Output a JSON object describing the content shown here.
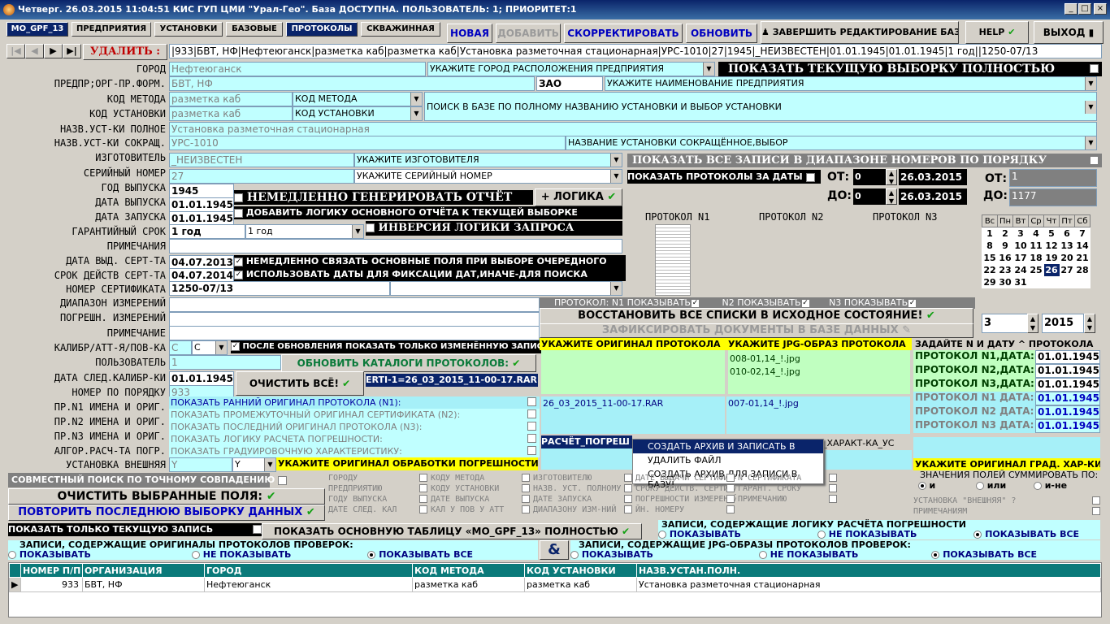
{
  "title": "Четверг. 26.03.2015 11:04:51 КИС ГУП ЦМИ \"Урал-Гео\". База ДОСТУПНА. ПОЛЬЗОВАТЕЛЬ: 1; ПРИОРИТЕТ:1",
  "tabs": [
    "MO_GPF_13",
    "ПРЕДПРИЯТИЯ",
    "УСТАНОВКИ",
    "БАЗОВЫЕ",
    "ПРОТОКОЛЫ",
    "СКВАЖИННАЯ"
  ],
  "actions": {
    "new": "НОВАЯ",
    "add": "ДОБАВИТЬ",
    "edit": "СКОРРЕКТИРОВАТЬ",
    "refresh": "ОБНОВИТЬ",
    "finish": "ЗАВЕРШИТЬ РЕДАКТИРОВАНИЕ БАЗЫ",
    "help": "HELP",
    "exit": "ВЫХОД"
  },
  "nav": {
    "delete": "УДАЛИТЬ :",
    "record": "|933|БВТ, НФ|Нефтеюганск|разметка каб|разметка каб|Установка разметочная стационарная|УРС-1010|27|1945|_НЕИЗВЕСТЕН|01.01.1945|01.01.1945|1 год||1250-07/13"
  },
  "labels": [
    "ГОРОД",
    "ПРЕДПР;ОРГ-ПР.ФОРМ.",
    "КОД МЕТОДА",
    "КОД УСТАНОВКИ",
    "НАЗВ.УСТ-КИ ПОЛНОЕ",
    "НАЗВ.УСТ-КИ СОКРАЩ.",
    "ИЗГОТОВИТЕЛЬ",
    "СЕРИЙНЫЙ НОМЕР",
    "ГОД ВЫПУСКА",
    "ДАТА ВЫПУСКА",
    "ДАТА ЗАПУСКА",
    "ГАРАНТИЙНЫЙ СРОК",
    "ПРИМЕЧАНИЯ",
    "ДАТА ВЫД. СЕРТ-ТА",
    "СРОК ДЕЙСТВ СЕРТ-ТА",
    "НОМЕР СЕРТИФИКАТА",
    "ДИАПАЗОН ИЗМЕРЕНИЙ",
    "ПОГРЕШН. ИЗМЕРЕНИЙ",
    "ПРИМЕЧАНИЕ",
    "КАЛИБР/АТТ-Я/ПОВ-КА",
    "ПОЛЬЗОВАТЕЛЬ",
    "ДАТА СЛЕД.КАЛИБР-КИ",
    "НОМЕР ПО ПОРЯДКУ",
    "ПР.N1 ИМЕНА И ОРИГ.",
    "ПР.N2 ИМЕНА И ОРИГ.",
    "ПР.N3 ИМЕНА И ОРИГ.",
    "АЛГОР.РАСЧ-ТА ПОГР.",
    "УСТАНОВКА ВНЕШНЯЯ"
  ],
  "fields": {
    "city": "Нефтеюганск",
    "city_hint": "УКАЖИТЕ ГОРОД РАСПОЛОЖЕНИЯ ПРЕДПРИЯТИЯ",
    "show_current": "ПОКАЗАТЬ ТЕКУЩУЮ ВЫБОРКУ ПОЛНОСТЬЮ",
    "org": "БВТ, НФ",
    "form": "ЗАО",
    "org_hint": "УКАЖИТЕ НАИМЕНОВАНИЕ ПРЕДПРИЯТИЯ",
    "method": "разметка каб",
    "method_sel": "КОД МЕТОДА",
    "unit": "разметка каб",
    "unit_sel": "КОД УСТАНОВКИ",
    "unit_search": "ПОИСК В БАЗЕ ПО ПОЛНОМУ НАЗВАНИЮ УСТАНОВКИ И ВЫБОР УСТАНОВКИ",
    "full_name": "Установка разметочная стационарная",
    "short_name": "УРС-1010",
    "short_hint": "НАЗВАНИЕ УСТАНОВКИ СОКРАЩЁННОЕ,ВЫБОР",
    "maker": "_НЕИЗВЕСТЕН",
    "maker_hint": "УКАЖИТЕ ИЗГОТОВИТЕЛЯ",
    "serial": "27",
    "serial_hint": "УКАЖИТЕ СЕРИЙНЫЙ НОМЕР",
    "year": "1945",
    "rel_date": "01.01.1945",
    "start_date": "01.01.1945",
    "warranty": "1 год",
    "warranty_sel": "1 год",
    "cert_date": "04.07.2013",
    "cert_valid": "04.07.2014",
    "cert_no": "1250-07/13",
    "calib": "С",
    "calib_sel": "С",
    "user": "1",
    "next_calib": "01.01.1945",
    "order_no": "933",
    "ext": "Y",
    "ext_sel": "Y"
  },
  "toggles": {
    "gen": "НЕМЕДЛЕННО ГЕНЕРИРОВАТЬ ОТЧЁТ",
    "logic": "+ ЛОГИКА",
    "add_logic": "ДОБАВИТЬ ЛОГИКУ ОСНОВНОГО ОТЧЁТА К ТЕКУЩЕЙ ВЫБОРКЕ",
    "invert": "ИНВЕРСИЯ ЛОГИКИ ЗАПРОСА",
    "link": "НЕМЕДЛЕННО СВЯЗАТЬ ОСНОВНЫЕ ПОЛЯ ПРИ ВЫБОРЕ ОЧЕРЕДНОГО",
    "use_dates": "ИСПОЛЬЗОВАТЬ ДАТЫ ДЛЯ ФИКСАЦИИ ДАТ,ИНАЧЕ-ДЛЯ ПОИСКА",
    "after_upd": "ПОСЛЕ ОБНОВЛЕНИЯ ПОКАЗАТЬ ТОЛЬКО ИЗМЕНЁННУЮ ЗАПИСЬ",
    "upd_cat": "ОБНОВИТЬ КАТАЛОГИ ПРОТОКОЛОВ:",
    "clear_all": "ОЧИСТИТЬ ВСЁ!",
    "rar": "ERTI-1=26_03_2015_11-00-17.RAR"
  },
  "range": {
    "show_all": "ПОКАЗАТЬ ВСЕ ЗАПИСИ В ДИАПАЗОНЕ НОМЕРОВ ПО ПОРЯДКУ",
    "by_date": "ПОКАЗАТЬ ПРОТОКОЛЫ ЗА ДАТЫ",
    "from": "ОТ:",
    "to": "ДО:",
    "from_n": "0",
    "to_n": "0",
    "from_d": "26.03.2015",
    "to_d": "26.03.2015",
    "from2": "1",
    "to2": "1177"
  },
  "protocols": {
    "p1": "ПРОТОКОЛ N1",
    "p2": "ПРОТОКОЛ N2",
    "p3": "ПРОТОКОЛ N3",
    "show_prefix": "ПРОТОКОЛ:",
    "s1": "N1 ПОКАЗЫВАТЬ",
    "s2": "N2 ПОКАЗЫВАТЬ",
    "s3": "N3 ПОКАЗЫВАТЬ",
    "restore": "ВОССТАНОВИТЬ ВСЕ СПИСКИ В ИСХОДНОЕ СОСТОЯНИЕ!",
    "fix": "ЗАФИКСИРОВАТЬ ДОКУМЕНТЫ В БАЗЕ ДАННЫХ"
  },
  "calendar": {
    "days": [
      "Вс",
      "Пн",
      "Вт",
      "Ср",
      "Чт",
      "Пт",
      "Сб"
    ],
    "weeks": [
      [
        "1",
        "2",
        "3",
        "4",
        "5",
        "6",
        "7"
      ],
      [
        "8",
        "9",
        "10",
        "11",
        "12",
        "13",
        "14"
      ],
      [
        "15",
        "16",
        "17",
        "18",
        "19",
        "20",
        "21"
      ],
      [
        "22",
        "23",
        "24",
        "25",
        "26",
        "27",
        "28"
      ],
      [
        "29",
        "30",
        "31",
        "",
        "",
        "",
        ""
      ]
    ],
    "selected": "26",
    "month": "3",
    "year": "2015"
  },
  "docs": {
    "orig_hdr": "УКАЖИТЕ ОРИГИНАЛ ПРОТОКОЛА",
    "jpg_hdr": "УКАЖИТЕ JPG-ОБРАЗ ПРОТОКОЛА",
    "date_hdr": "ЗАДАЙТЕ N И ДАТУ ^ ПРОТОКОЛА",
    "jpg1": "008-01,14_!.jpg",
    "jpg2": "010-02,14_!.jpg",
    "rar": "26_03_2015_11-00-17.RAR",
    "jpg3": "007-01,14_!.jpg",
    "calc": "РАСЧЁТ_ПОГРЕШ",
    "calc2": "_ХАРАКТ-КА_УС",
    "grad_hdr": "УКАЖИТЕ ОРИГИНАЛ ГРАД. ХАР-КИ",
    "sum": "ЗНАЧЕНИЯ ПОЛЕЙ СУММИРОВАТЬ ПО:",
    "and": "и",
    "or": "или",
    "not": "и-не"
  },
  "dates": [
    {
      "l": "ПРОТОКОЛ N1,ДАТА:",
      "v": "01.01.1945"
    },
    {
      "l": "ПРОТОКОЛ N2,ДАТА:",
      "v": "01.01.1945"
    },
    {
      "l": "ПРОТОКОЛ N3,ДАТА:",
      "v": "01.01.1945"
    },
    {
      "l": "ПРОТОКОЛ N1 ДАТА:",
      "v": "01.01.1945"
    },
    {
      "l": "ПРОТОКОЛ N2 ДАТА:",
      "v": "01.01.1945"
    },
    {
      "l": "ПРОТОКОЛ N3 ДАТА:",
      "v": "01.01.1945"
    }
  ],
  "ctx": [
    "СОЗДАТЬ АРХИВ И ЗАПИСАТЬ В БАЗУ !",
    "УДАЛИТЬ ФАЙЛ",
    "СОЗДАТЬ АРХИВ ДЛЯ ЗАПИСИ В БАЗУ!"
  ],
  "showrows": [
    "ПОКАЗАТЬ РАННИЙ ОРИГИНАЛ ПРОТОКОЛА (N1):",
    "ПОКАЗАТЬ ПРОМЕЖУТОЧНЫЙ ОРИГИНАЛ СЕРТИФИКАТА (N2):",
    "ПОКАЗАТЬ ПОСЛЕДНИЙ ОРИГИНАЛ ПРОТОКОЛА (N3):",
    "ПОКАЗАТЬ ЛОГИКУ РАСЧЕТА ПОГРЕШНОСТИ:",
    "ПОКАЗАТЬ ГРАДУИРОВОЧНУЮ ХАРАКТЕРИСТИКУ:"
  ],
  "proc_hint": "УКАЖИТЕ ОРИГИНАЛ ОБРАБОТКИ ПОГРЕШНОСТИ",
  "joint": "СОВМЕСТНЫЙ ПОИСК ПО ТОЧНОМУ СОВПАДЕНИЮ",
  "clear_fields": "ОЧИСТИТЬ ВЫБРАННЫЕ ПОЛЯ:",
  "repeat": "ПОВТОРИТЬ ПОСЛЕДНЮЮ ВЫБОРКУ ДАННЫХ",
  "only_cur": "ПОКАЗАТЬ ТОЛЬКО ТЕКУЩУЮ ЗАПИСЬ",
  "show_main": "ПОКАЗАТЬ ОСНОВНУЮ ТАБЛИЦУ «MO_GPF_13» ПОЛНОСТЬЮ",
  "search_fields": [
    "ГОРОДУ",
    "ПРЕДПРИЯТИЮ",
    "ГОДУ ВЫПУСКА",
    "ДАТЕ СЛЕД. КАЛ",
    "КОДУ МЕТОДА",
    "КОДУ УСТАНОВКИ",
    "ДАТЕ ВЫПУСКА",
    "КАЛ У ПОВ У АТТ",
    "ИЗГОТОВИТЕЛЮ",
    "НАЗВ. УСТ. ПОЛНОМУ",
    "ДАТЕ ЗАПУСКА",
    "ДИАПАЗОНУ ИЗМ-НИЙ",
    "ДАТЕ ВЫДАЧИ СЕРТИФИКАТА",
    "СРОКУ ДЕЙСТВ. СЕРТИФИКАТА",
    "ПОГРЕШНОСТИ ИЗМЕРЕНИЙ",
    "ЙН. НОМЕРУ",
    "N СЕРТИФИКАТА",
    "ГАРАНТ. СРОКУ",
    "ПРИМЕЧАНИЮ",
    "УСТАНОВКА \"ВНЕШНЯЯ\" ?",
    "ПРИМЕЧАНИЯМ"
  ],
  "filters": {
    "logic_title": "ЗАПИСИ, СОДЕРЖАЩИЕ ЛОГИКУ РАСЧЁТА ПОГРЕШНОСТИ",
    "orig_title": "ЗАПИСИ, СОДЕРЖАЩИЕ ОРИГИНАЛЫ ПРОТОКОЛОВ ПРОВЕРОК:",
    "jpg_title": "ЗАПИСИ, СОДЕРЖАЩИЕ JPG-ОБРАЗЫ ПРОТОКОЛОВ ПРОВЕРОК:",
    "show": "ПОКАЗЫВАТЬ",
    "hide": "НЕ ПОКАЗЫВАТЬ",
    "all": "ПОКАЗЫВАТЬ ВСЕ",
    "amp": "&"
  },
  "table": {
    "cols": [
      "НОМЕР П/П",
      "ОРГАНИЗАЦИЯ",
      "ГОРОД",
      "КОД МЕТОДА",
      "КОД УСТАНОВКИ",
      "НАЗВ.УСТАН.ПОЛН."
    ],
    "row": [
      "933",
      "БВТ, НФ",
      "Нефтеюганск",
      "разметка каб",
      "разметка каб",
      "Установка разметочная стационарная"
    ]
  }
}
